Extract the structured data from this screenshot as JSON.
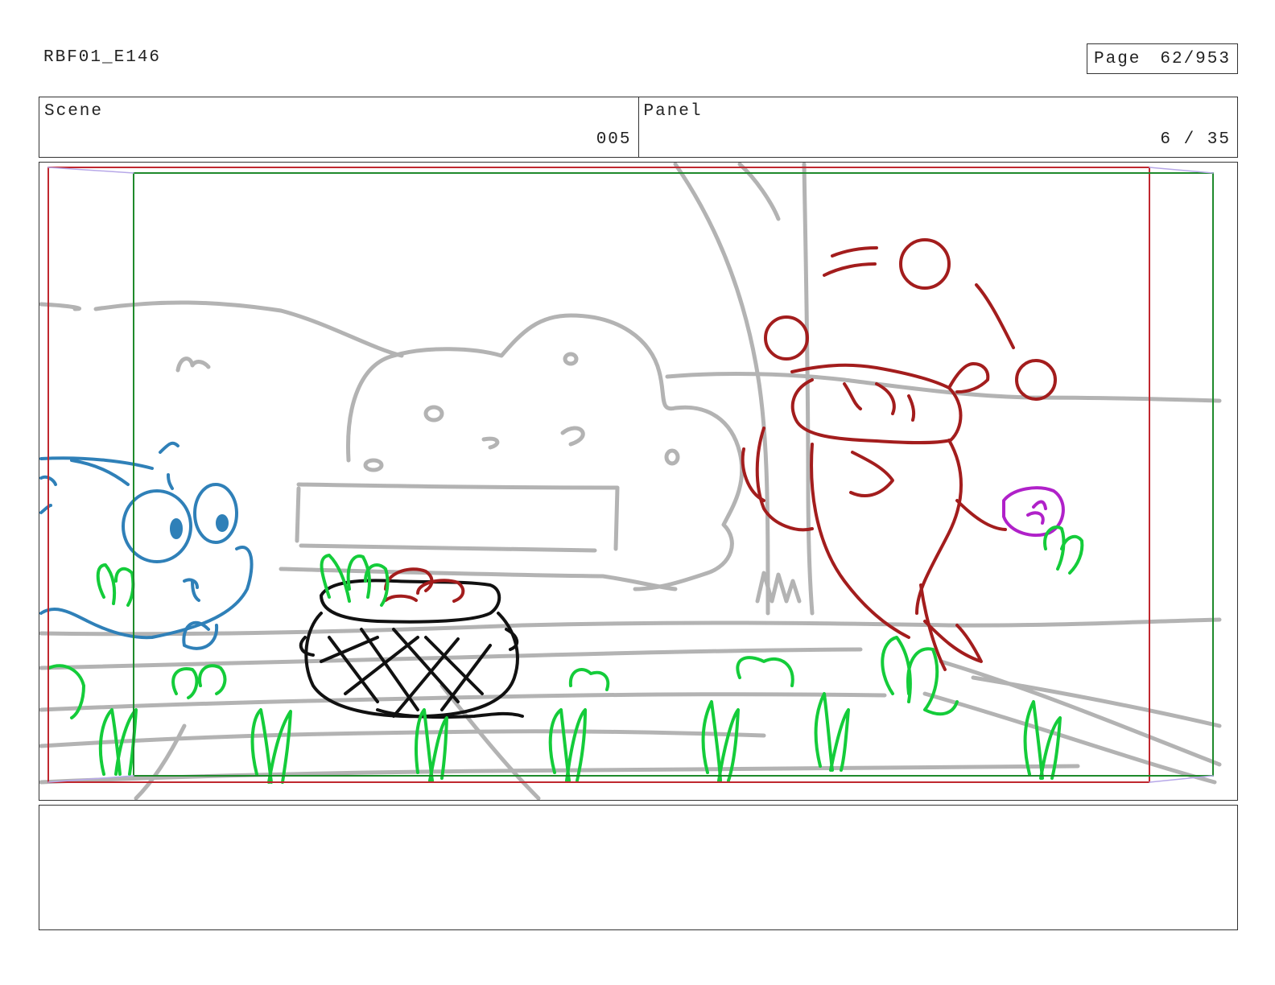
{
  "header": {
    "episode_code": "RBF01_E146",
    "page_label": "Page",
    "page_value": "62/953"
  },
  "info_table": {
    "scene_label": "Scene",
    "scene_value": "005",
    "panel_label": "Panel",
    "panel_value": "6 / 35"
  },
  "notes": {
    "text": ""
  },
  "colors": {
    "background_lines": "#b3b3b3",
    "character_blue": "#2f80b8",
    "character_red": "#a31d1d",
    "grass_green": "#14cc3a",
    "basket_black": "#111111",
    "safe_frame_red": "#c0282f",
    "safe_frame_green": "#1f8a2c",
    "accent_purple": "#b021c9"
  }
}
